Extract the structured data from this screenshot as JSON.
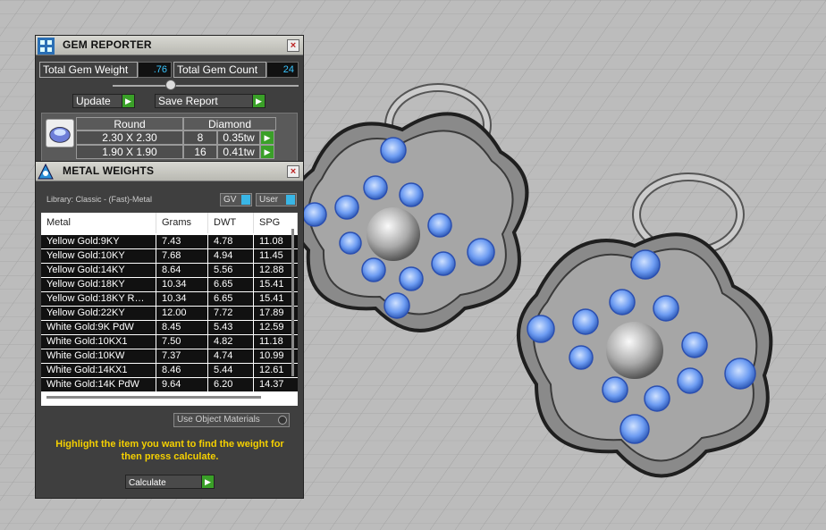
{
  "gem_reporter": {
    "title": "GEM REPORTER",
    "close": "×",
    "total_weight_label": "Total Gem Weight",
    "total_weight_value": ".76",
    "total_count_label": "Total Gem Count",
    "total_count_value": "24",
    "update_label": "Update",
    "save_report_label": "Save Report",
    "go_glyph": "▶",
    "gem_shape": "Round",
    "gem_type": "Diamond",
    "rows": [
      {
        "size": "2.30 X 2.30",
        "count": "8",
        "tw": "0.35tw"
      },
      {
        "size": "1.90 X 1.90",
        "count": "16",
        "tw": "0.41tw"
      }
    ]
  },
  "metal_weights": {
    "title": "METAL WEIGHTS",
    "close": "×",
    "library_label": "Library: Classic - (Fast)-Metal",
    "gv_label": "GV",
    "user_label": "User",
    "columns": [
      "Metal",
      "Grams",
      "DWT",
      "SPG"
    ],
    "rows": [
      [
        "Yellow Gold:9KY",
        "7.43",
        "4.78",
        "11.08"
      ],
      [
        "Yellow Gold:10KY",
        "7.68",
        "4.94",
        "11.45"
      ],
      [
        "Yellow Gold:14KY",
        "8.64",
        "5.56",
        "12.88"
      ],
      [
        "Yellow Gold:18KY",
        "10.34",
        "6.65",
        "15.41"
      ],
      [
        "Yellow Gold:18KY R…",
        "10.34",
        "6.65",
        "15.41"
      ],
      [
        "Yellow Gold:22KY",
        "12.00",
        "7.72",
        "17.89"
      ],
      [
        "White Gold:9K PdW",
        "8.45",
        "5.43",
        "12.59"
      ],
      [
        "White Gold:10KX1",
        "7.50",
        "4.82",
        "11.18"
      ],
      [
        "White Gold:10KW",
        "7.37",
        "4.74",
        "10.99"
      ],
      [
        "White Gold:14KX1",
        "8.46",
        "5.44",
        "12.61"
      ],
      [
        "White Gold:14K PdW",
        "9.64",
        "6.20",
        "14.37"
      ]
    ],
    "use_materials_label": "Use Object Materials",
    "hint": "Highlight the item you want to find the weight for then press calculate.",
    "calculate_label": "Calculate"
  },
  "colors": {
    "accent_go": "#3aa028",
    "gem_blue": "#6aa0ff",
    "hint_yellow": "#f5d000"
  }
}
